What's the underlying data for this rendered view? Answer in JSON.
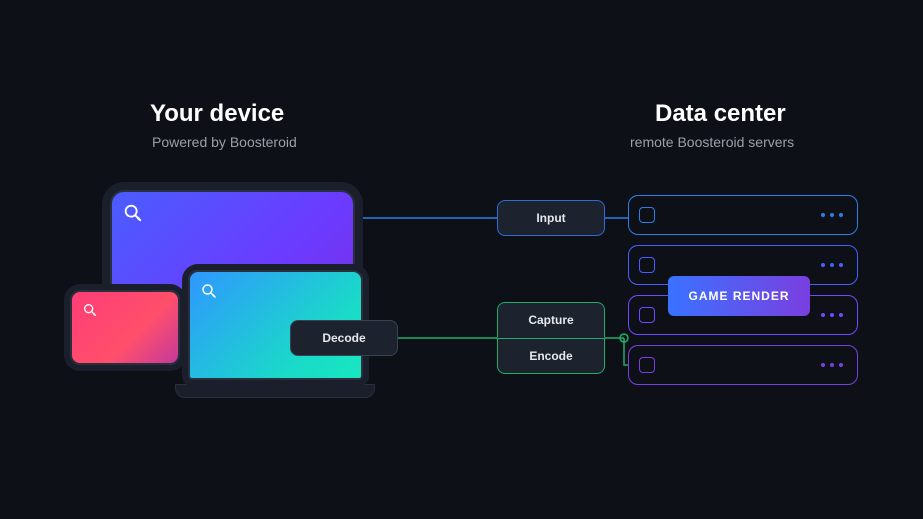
{
  "left": {
    "title": "Your device",
    "subtitle": "Powered by Boosteroid"
  },
  "right": {
    "title": "Data center",
    "subtitle": "remote Boosteroid servers"
  },
  "chips": {
    "decode": "Decode",
    "input": "Input",
    "capture": "Capture",
    "encode": "Encode"
  },
  "badge": {
    "game_render": "GAME RENDER"
  }
}
